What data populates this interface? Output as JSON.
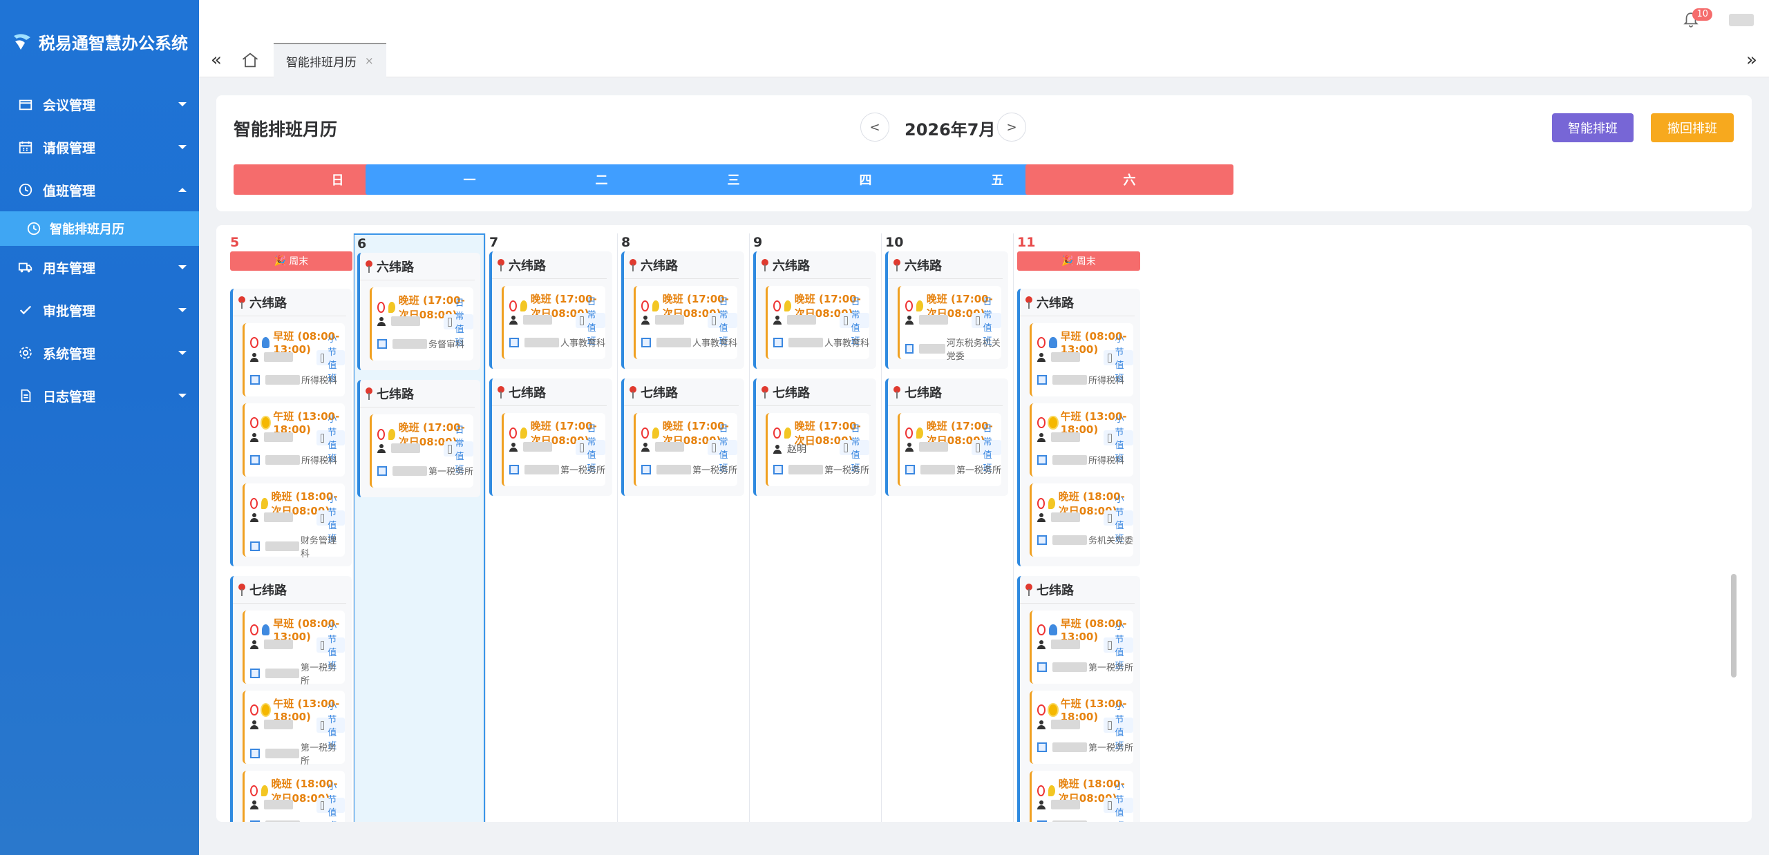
{
  "app": {
    "title": "税易通智慧办公系统"
  },
  "sidebar": {
    "items": [
      {
        "label": "会议管理",
        "icon": "calendar-icon"
      },
      {
        "label": "请假管理",
        "icon": "calendar-grid-icon"
      },
      {
        "label": "值班管理",
        "icon": "clock-icon",
        "expanded": true
      },
      {
        "label": "用车管理",
        "icon": "truck-icon"
      },
      {
        "label": "审批管理",
        "icon": "check-icon"
      },
      {
        "label": "系统管理",
        "icon": "gear-icon"
      },
      {
        "label": "日志管理",
        "icon": "document-icon"
      }
    ],
    "active_sub": {
      "label": "智能排班月历",
      "icon": "clock-icon"
    }
  },
  "topbar": {
    "notification_count": "10"
  },
  "tabs": [
    {
      "label": "智能排班月历"
    }
  ],
  "header": {
    "title": "智能排班月历",
    "month": "2026年7月",
    "prev": "<",
    "next": ">",
    "smart_button": "智能排班",
    "undo_button": "撤回排班",
    "weekdays": [
      "日",
      "一",
      "二",
      "三",
      "四",
      "五",
      "六"
    ]
  },
  "colors": {
    "weekend": "#f56c6c",
    "weekday": "#409eff",
    "smart": "#7766d6",
    "undo": "#f7a91e"
  },
  "calendar": {
    "weekend_label": "周末",
    "days": [
      {
        "num": "5",
        "weekend": true,
        "groups": [
          {
            "name": "六纬路",
            "shifts": [
              {
                "time": "早班 (08:00-13:00)",
                "icon": "bell",
                "tag": "小节值班",
                "dept": "所得税科"
              },
              {
                "time": "午班 (13:00-18:00)",
                "icon": "sun",
                "tag": "小节值班",
                "dept": "所得税科"
              },
              {
                "time": "晚班 (18:00-次日08:00)",
                "icon": "moon",
                "tag": "小节值班",
                "dept": "财务管理科"
              }
            ]
          },
          {
            "name": "七纬路",
            "shifts": [
              {
                "time": "早班 (08:00-13:00)",
                "icon": "bell",
                "tag": "小节值班",
                "dept": "第一税务所"
              },
              {
                "time": "午班 (13:00-18:00)",
                "icon": "sun",
                "tag": "小节值班",
                "dept": "第一税务所"
              },
              {
                "time": "晚班 (18:00-次日08:00)",
                "icon": "moon",
                "tag": "小节值班",
                "dept": ""
              }
            ]
          }
        ]
      },
      {
        "num": "6",
        "selected": true,
        "groups": [
          {
            "name": "六纬路",
            "shifts": [
              {
                "time": "晚班 (17:00-次日08:00)",
                "icon": "moon",
                "tag": "日常值班",
                "dept": "务督审科"
              }
            ]
          },
          {
            "name": "七纬路",
            "shifts": [
              {
                "time": "晚班 (17:00-次日08:00)",
                "icon": "moon",
                "tag": "日常值班",
                "dept": "第一税务所"
              }
            ]
          }
        ]
      },
      {
        "num": "7",
        "groups": [
          {
            "name": "六纬路",
            "shifts": [
              {
                "time": "晚班 (17:00-次日08:00)",
                "icon": "moon",
                "tag": "日常值班",
                "dept": "人事教育科"
              }
            ]
          },
          {
            "name": "七纬路",
            "shifts": [
              {
                "time": "晚班 (17:00-次日08:00)",
                "icon": "moon",
                "tag": "日常值班",
                "dept": "第一税务所"
              }
            ]
          }
        ]
      },
      {
        "num": "8",
        "groups": [
          {
            "name": "六纬路",
            "shifts": [
              {
                "time": "晚班 (17:00-次日08:00)",
                "icon": "moon",
                "tag": "日常值班",
                "dept": "人事教育科"
              }
            ]
          },
          {
            "name": "七纬路",
            "shifts": [
              {
                "time": "晚班 (17:00-次日08:00)",
                "icon": "moon",
                "tag": "日常值班",
                "dept": "第一税务所"
              }
            ]
          }
        ]
      },
      {
        "num": "9",
        "groups": [
          {
            "name": "六纬路",
            "shifts": [
              {
                "time": "晚班 (17:00-次日08:00)",
                "icon": "moon",
                "tag": "日常值班",
                "dept": "人事教育科"
              }
            ]
          },
          {
            "name": "七纬路",
            "shifts": [
              {
                "time": "晚班 (17:00-次日08:00)",
                "icon": "moon",
                "tag": "日常值班",
                "person": "赵明",
                "dept": "第一税务所"
              }
            ]
          }
        ]
      },
      {
        "num": "10",
        "groups": [
          {
            "name": "六纬路",
            "shifts": [
              {
                "time": "晚班 (17:00-次日08:00)",
                "icon": "moon",
                "tag": "日常值班",
                "dept": "河东税务机关党委"
              }
            ]
          },
          {
            "name": "七纬路",
            "shifts": [
              {
                "time": "晚班 (17:00-次日08:00)",
                "icon": "moon",
                "tag": "日常值班",
                "dept": "第一税务所"
              }
            ]
          }
        ]
      },
      {
        "num": "11",
        "weekend": true,
        "groups": [
          {
            "name": "六纬路",
            "shifts": [
              {
                "time": "早班 (08:00-13:00)",
                "icon": "bell",
                "tag": "小节值班",
                "dept": "所得税科"
              },
              {
                "time": "午班 (13:00-18:00)",
                "icon": "sun",
                "tag": "小节值班",
                "dept": "所得税科"
              },
              {
                "time": "晚班 (18:00-次日08:00)",
                "icon": "moon",
                "tag": "小节值班",
                "dept": "务机关党委"
              }
            ]
          },
          {
            "name": "七纬路",
            "shifts": [
              {
                "time": "早班 (08:00-13:00)",
                "icon": "bell",
                "tag": "小节值班",
                "dept": "第一税务所"
              },
              {
                "time": "午班 (13:00-18:00)",
                "icon": "sun",
                "tag": "小节值班",
                "dept": "第一税务所"
              },
              {
                "time": "晚班 (18:00-次日08:00)",
                "icon": "moon",
                "tag": "小节值班",
                "dept": ""
              }
            ]
          }
        ]
      }
    ]
  }
}
